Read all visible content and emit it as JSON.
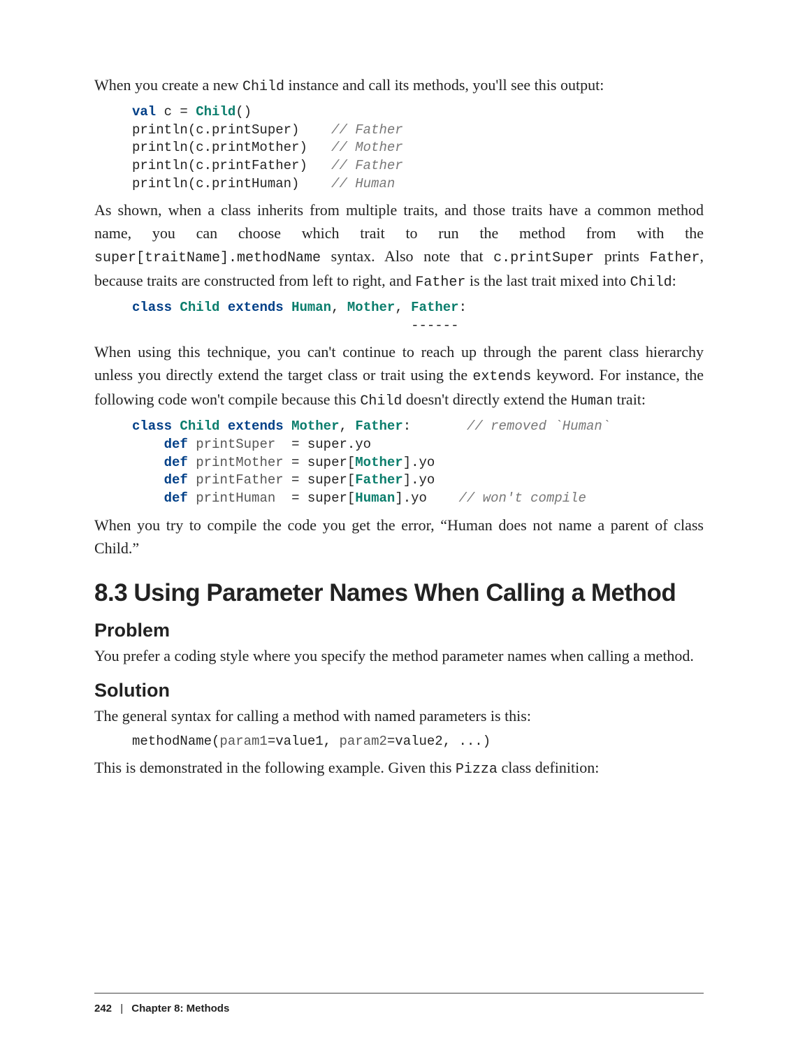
{
  "para1_a": "When you create a new ",
  "para1_code": "Child",
  "para1_b": " instance and call its methods, you'll see this output:",
  "code1_l1_kw": "val",
  "code1_l1_a": " c = ",
  "code1_l1_type": "Child",
  "code1_l1_b": "()",
  "code1_l2_a": "println(c.printSuper)    ",
  "code1_l2_com": "// Father",
  "code1_l3_a": "println(c.printMother)   ",
  "code1_l3_com": "// Mother",
  "code1_l4_a": "println(c.printFather)   ",
  "code1_l4_com": "// Father",
  "code1_l5_a": "println(c.printHuman)    ",
  "code1_l5_com": "// Human",
  "para2_a": "As shown, when a class inherits from multiple traits, and those traits have a common method name, you can choose which trait to run the method from with the ",
  "para2_code1": "super[traitName].methodName",
  "para2_b": " syntax. Also note that ",
  "para2_code2": "c.printSuper",
  "para2_c": " prints ",
  "para2_code3": "Father",
  "para2_d": ", because traits are constructed from left to right, and ",
  "para2_code4": "Father",
  "para2_e": " is the last trait mixed into ",
  "para2_code5": "Child",
  "para2_f": ":",
  "code2_kw1": "class",
  "code2_sp1": " ",
  "code2_type1": "Child",
  "code2_sp2": " ",
  "code2_kw2": "extends",
  "code2_sp3": " ",
  "code2_type2": "Human",
  "code2_sp4": ", ",
  "code2_type3": "Mother",
  "code2_sp5": ", ",
  "code2_type4": "Father",
  "code2_sp6": ":",
  "code2_dash": "                                   ------",
  "para3_a": "When using this technique, you can't continue to reach up through the parent class hierarchy unless you directly extend the target class or trait using the ",
  "para3_code1": "extends",
  "para3_b": " key­word. For instance, the following code won't compile because this ",
  "para3_code2": "Child",
  "para3_c": " doesn't directly extend the ",
  "para3_code3": "Human",
  "para3_d": " trait:",
  "code3_l1_kw1": "class",
  "code3_l1_sp1": " ",
  "code3_l1_type1": "Child",
  "code3_l1_sp2": " ",
  "code3_l1_kw2": "extends",
  "code3_l1_sp3": " ",
  "code3_l1_type2": "Mother",
  "code3_l1_sp4": ", ",
  "code3_l1_type3": "Father",
  "code3_l1_sp5": ":       ",
  "code3_l1_com": "// removed `Human`",
  "code3_l2_pad": "    ",
  "code3_l2_kw": "def",
  "code3_l2_sp1": " ",
  "code3_l2_name": "printSuper",
  "code3_l2_rest": "  = super.yo",
  "code3_l3_pad": "    ",
  "code3_l3_kw": "def",
  "code3_l3_sp1": " ",
  "code3_l3_name": "printMother",
  "code3_l3_rest_a": " = super[",
  "code3_l3_type": "Mother",
  "code3_l3_rest_b": "].yo",
  "code3_l4_pad": "    ",
  "code3_l4_kw": "def",
  "code3_l4_sp1": " ",
  "code3_l4_name": "printFather",
  "code3_l4_rest_a": " = super[",
  "code3_l4_type": "Father",
  "code3_l4_rest_b": "].yo",
  "code3_l5_pad": "    ",
  "code3_l5_kw": "def",
  "code3_l5_sp1": " ",
  "code3_l5_name": "printHuman",
  "code3_l5_rest_a": "  = super[",
  "code3_l5_type": "Human",
  "code3_l5_rest_b": "].yo    ",
  "code3_l5_com": "// won't compile",
  "para4": "When you try to compile the code you get the error, “Human does not name a parent of class Child.”",
  "heading_section": "8.3 Using Parameter Names When Calling a Method",
  "heading_problem": "Problem",
  "para_problem": "You prefer a coding style where you specify the method parameter names when call­ing a method.",
  "heading_solution": "Solution",
  "para_solution_a": "The general syntax for calling a method with named parameters is this:",
  "code4_a": "methodName(",
  "code4_name1": "param1",
  "code4_b": "=value1, ",
  "code4_name2": "param2",
  "code4_c": "=value2, ...)",
  "para5_a": "This is demonstrated in the following example. Given this ",
  "para5_code": "Pizza",
  "para5_b": " class definition:",
  "footer_page": "242",
  "footer_sep": "|",
  "footer_chapter": "Chapter 8: Methods"
}
